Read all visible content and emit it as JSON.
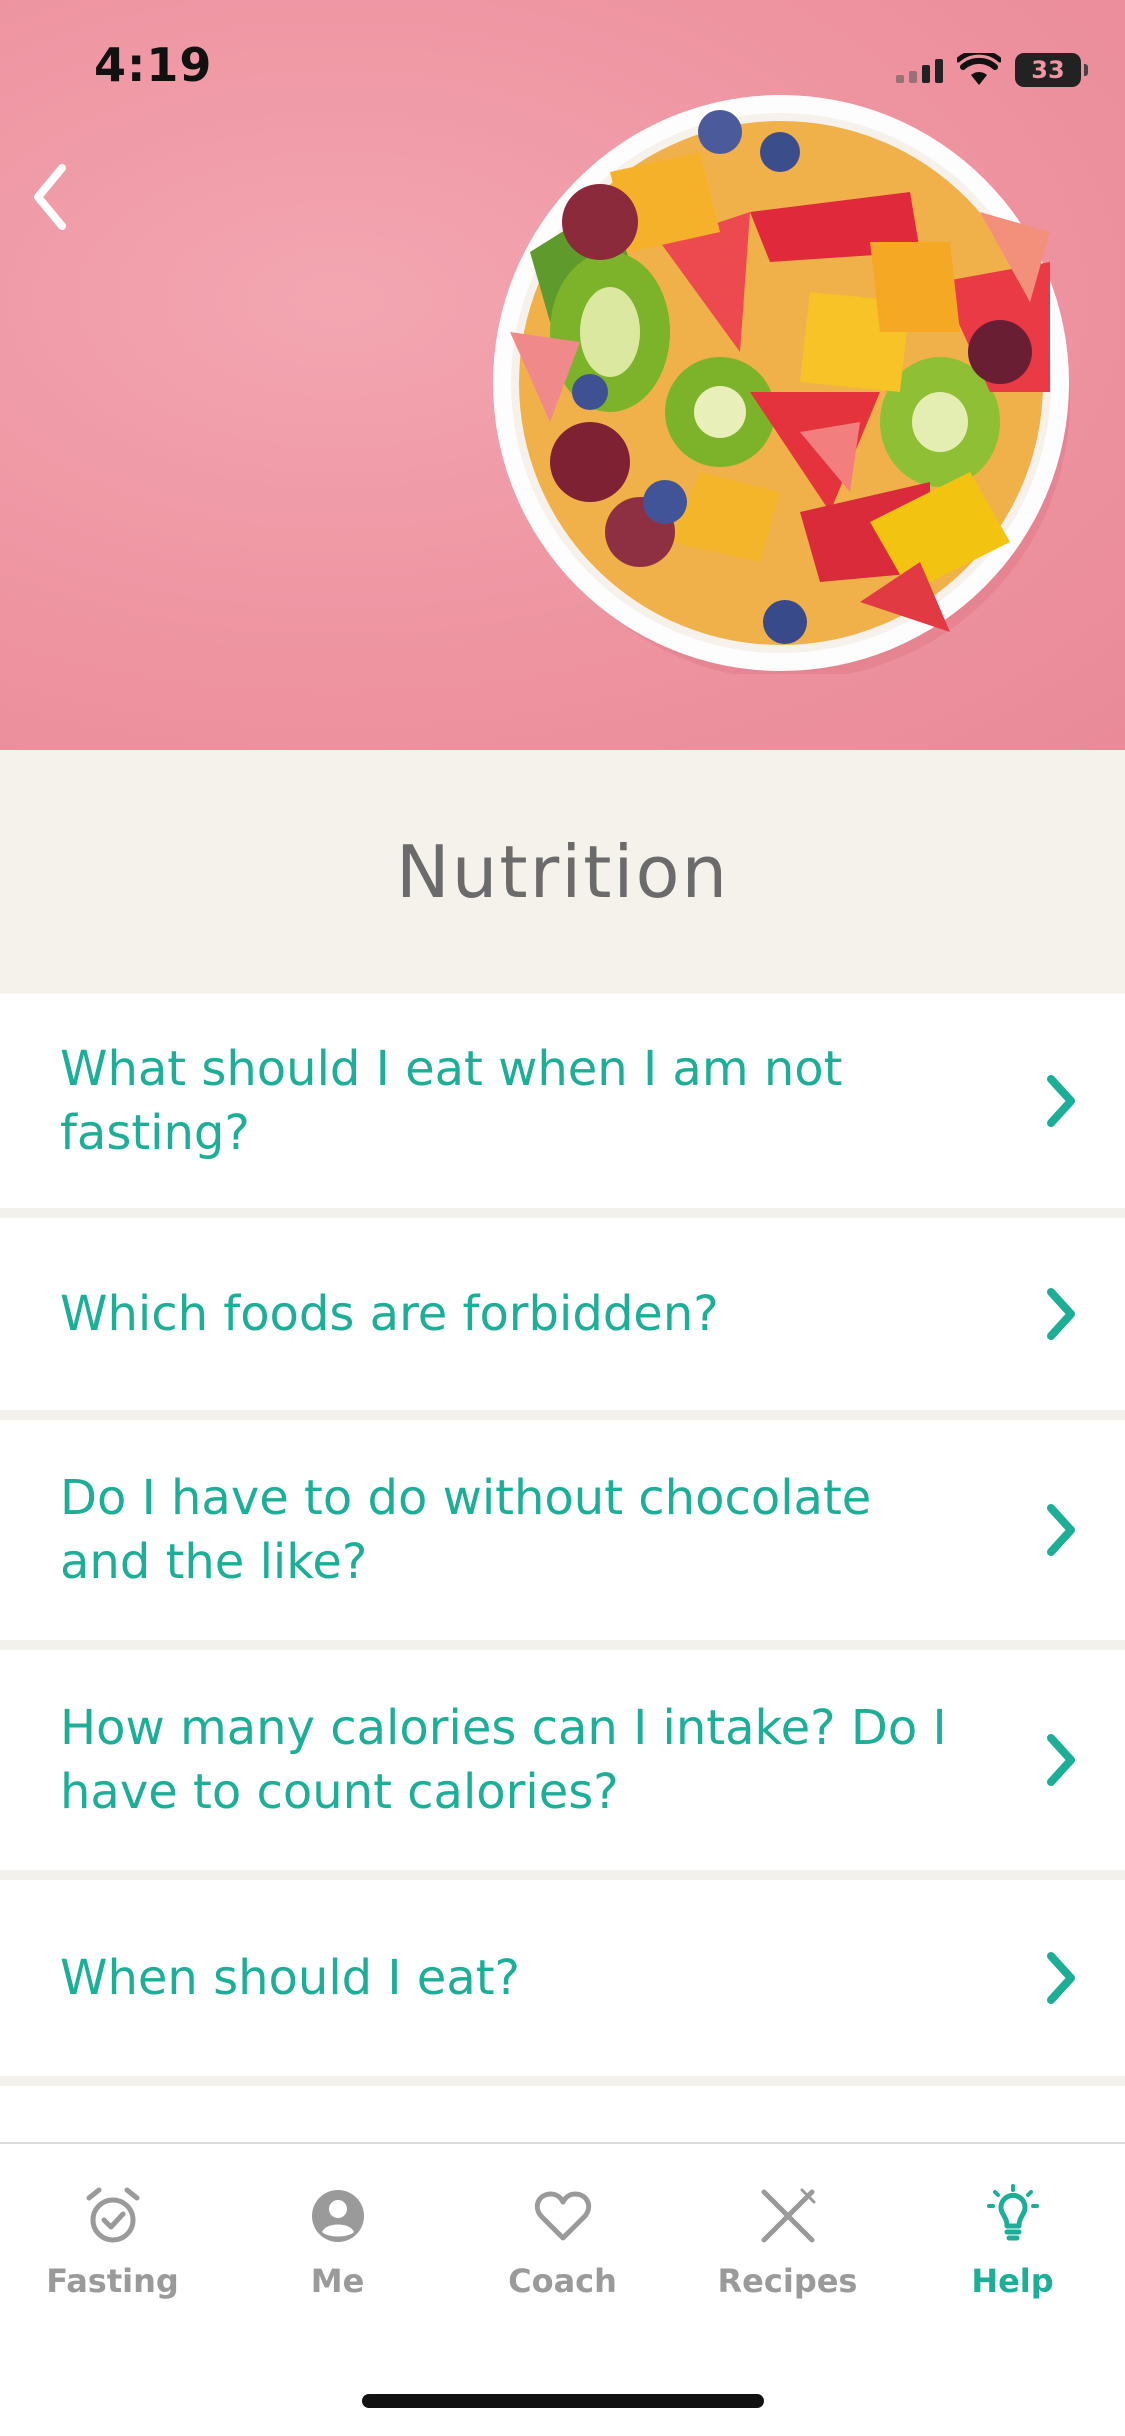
{
  "status_bar": {
    "time": "4:19",
    "battery": "33"
  },
  "hero": {
    "image": "fruit-salad-bowl"
  },
  "section": {
    "title": "Nutrition"
  },
  "faq": [
    {
      "question": "What should I eat when I am not fasting?"
    },
    {
      "question": "Which foods are forbidden?"
    },
    {
      "question": "Do I have to do without chocolate and the like?"
    },
    {
      "question": "How many calories can I intake? Do I have to count calories?"
    },
    {
      "question": "When should I eat?"
    }
  ],
  "tabbar": {
    "active": "Help",
    "accent_color": "#1cae96",
    "tabs": [
      {
        "label": "Fasting",
        "icon": "alarm-check-icon"
      },
      {
        "label": "Me",
        "icon": "person-icon"
      },
      {
        "label": "Coach",
        "icon": "heart-icon"
      },
      {
        "label": "Recipes",
        "icon": "fork-knife-icon"
      },
      {
        "label": "Help",
        "icon": "lightbulb-icon"
      }
    ]
  }
}
